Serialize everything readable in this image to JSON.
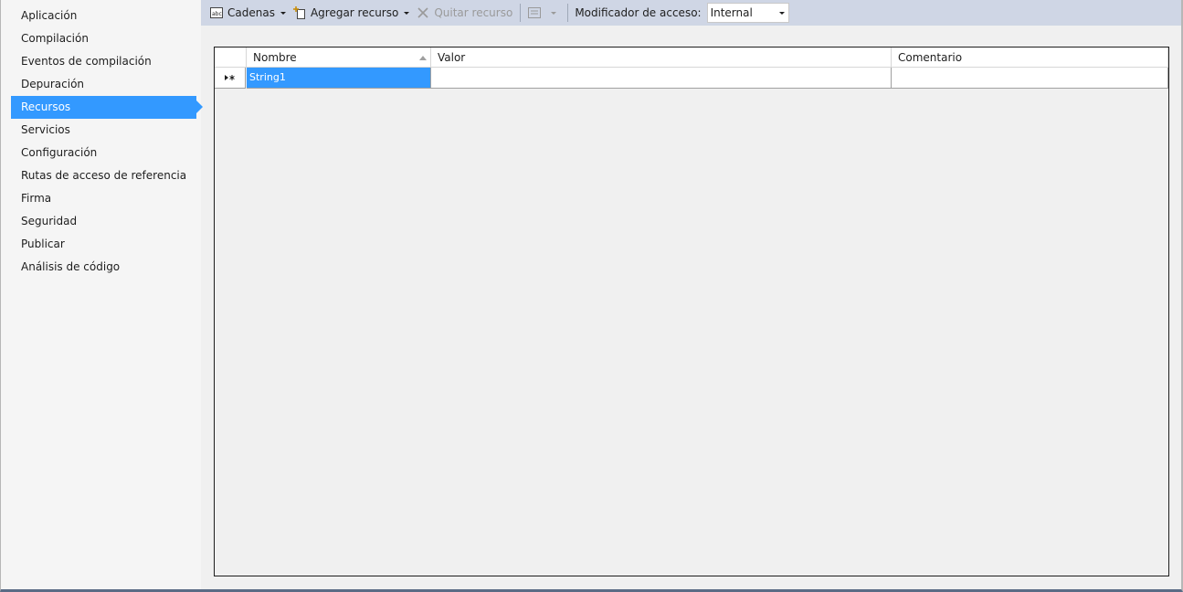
{
  "sidebar": {
    "items": [
      {
        "label": "Aplicación"
      },
      {
        "label": "Compilación"
      },
      {
        "label": "Eventos de compilación"
      },
      {
        "label": "Depuración"
      },
      {
        "label": "Recursos",
        "active": true
      },
      {
        "label": "Servicios"
      },
      {
        "label": "Configuración"
      },
      {
        "label": "Rutas de acceso de referencia"
      },
      {
        "label": "Firma"
      },
      {
        "label": "Seguridad"
      },
      {
        "label": "Publicar"
      },
      {
        "label": "Análisis de código"
      }
    ]
  },
  "toolbar": {
    "resource_type_label": "Cadenas",
    "add_resource_label": "Agregar recurso",
    "remove_resource_label": "Quitar recurso",
    "access_modifier_label": "Modificador de acceso:",
    "access_modifier_value": "Internal"
  },
  "grid": {
    "columns": [
      "Nombre",
      "Valor",
      "Comentario"
    ],
    "rows": [
      {
        "nombre": "String1",
        "valor": "",
        "comentario": ""
      }
    ]
  },
  "colors": {
    "accent": "#3399ff",
    "toolbar_bg": "#cfd6e5",
    "sidebar_bg": "#f5f5f5",
    "content_bg": "#f0f0f0"
  }
}
